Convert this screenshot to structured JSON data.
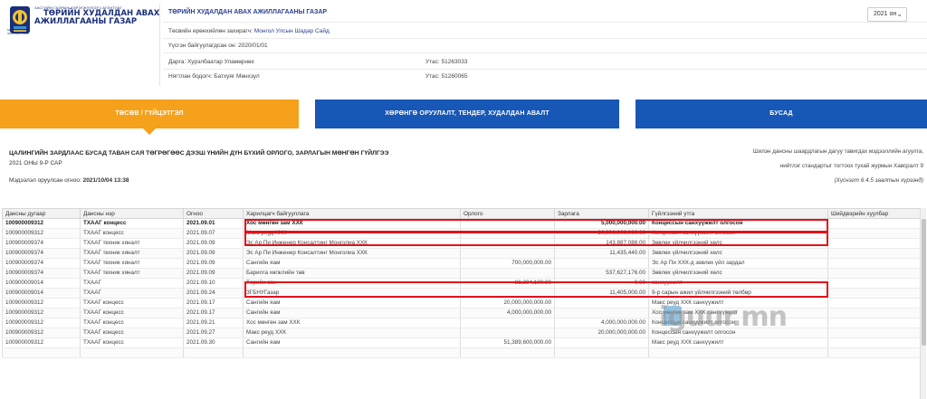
{
  "header": {
    "logo_small": "ЗАСГИЙН ГАЗРЫН ХЭРЭГЖҮҮЛЭГЧ АГЕНТЛАГ",
    "logo_line1": "ТӨРИЙН ХУДАЛДАН АВАХ",
    "logo_line2": "АЖИЛЛАГААНЫ ГАЗАР",
    "emblem_side_text": "МОНГОЛ УЛСЫН ЗАСГИЙН ГАЗАР",
    "org_title": "ТӨРИЙН ХУДАЛДАН АВАХ АЖИЛЛАГААНЫ ГАЗАР",
    "budget_manager_label": "Төсвийн ерөнхийлөн захирагч:",
    "budget_manager_value": "Монгол Улсын Шадар Сайд",
    "established_label": "Үүсгэн байгуулагдсан он: 2020/01/01",
    "director": "Дарга: Хурэлбаатар Уламөрнөх",
    "director_phone": "Утас: 51263033",
    "accountant": "Нягтлан бодогч: Батхуяг Мөнхзул",
    "accountant_phone": "Утас: 51260065",
    "year": "2021 он",
    "year_chevron": "⌄"
  },
  "tabs": [
    {
      "label": "ТӨСӨВ / ГҮЙЦЭТГЭЛ"
    },
    {
      "label": "ХӨРӨНГӨ ОРУУЛАЛТ, ТЕНДЕР, ХУДАЛДАН АВАЛТ"
    },
    {
      "label": "БУСАД"
    }
  ],
  "report": {
    "title": "ЦАЛИНГИЙН ЗАРДЛААС БУСАД ТАВАН САЯ ТӨГРӨГӨӨС ДЭЭШ ҮНИЙН ДҮН БҮХИЙ ОРЛОГО, ЗАРЛАГЫН МӨНГӨН ГҮЙЛГЭЭ",
    "subtitle": "2021 ОНЫ 9-Р САР",
    "date_label": "Мэдээлэл оруулсан огноо:",
    "date_value": "2021/10/04 13:38",
    "note_line1": "Шилэн дансны шаардлагын дагуу тавигдах мэдээллийн агуулга,",
    "note_line2": "нийтлэг стандартыг тогтоох тухай журмын Хавсралт 9",
    "note_line3": "(Хүснэгт 6.4.5 заалтын хүрээнд)"
  },
  "table": {
    "headers": [
      "Дансны дугаар",
      "Дансны нэр",
      "Огноо",
      "Харилцагч байгууллага",
      "Орлого",
      "Зарлага",
      "Гүйлгээний утга",
      "Шийдвэрийн хуулбар"
    ],
    "rows": [
      {
        "acc": "100900009312",
        "name": "ТХААГ концесс",
        "date": "2021.09.01",
        "party": "Хос мөнгөн зам ХХК",
        "income": "",
        "expense": "5,000,000,000.00",
        "purpose": "Концессын санхүүжилт олгосон",
        "doc": "",
        "bold": true
      },
      {
        "acc": "100900009312",
        "name": "ТХААГ концесс",
        "date": "2021.09.07",
        "party": "Макс реуд ХХК",
        "income": "",
        "expense": "20,000,000,000.00",
        "purpose": "Концессын санхүүжилт олгосон",
        "doc": ""
      },
      {
        "acc": "100900009374",
        "name": "ТХААГ техник хяналт",
        "date": "2021.09.09",
        "party": "Эс Ар Пи Инженер Консалтинг Монголиа ХХК",
        "income": "",
        "expense": "143,887,088.00",
        "purpose": "Зөвлөх үйлчилгээний хөлс",
        "doc": ""
      },
      {
        "acc": "100900009374",
        "name": "ТХААГ техник хяналт",
        "date": "2021.09.09",
        "party": "Эс Ар Пи Инженер Консалтинг Монголиа ХХК",
        "income": "",
        "expense": "11,435,440.00",
        "purpose": "Зөвлөх үйлчилгээний хөлс",
        "doc": ""
      },
      {
        "acc": "100900009374",
        "name": "ТХААГ техник хяналт",
        "date": "2021.09.09",
        "party": "Сангийн яам",
        "income": "700,000,000.00",
        "expense": "",
        "purpose": "Эс Ар Пи ХХК-д зөвлөх үйл зардал",
        "doc": ""
      },
      {
        "acc": "100900009374",
        "name": "ТХААГ техник хяналт",
        "date": "2021.09.09",
        "party": "Барилга хөгжлийн төв",
        "income": "",
        "expense": "537,627,176.00",
        "purpose": "Зөвлөх үйлчилгээний хөлс",
        "doc": ""
      },
      {
        "acc": "100900009014",
        "name": "ТХААГ",
        "date": "2021.09.10",
        "party": "Төрийн сан",
        "income": "81,394,100.00",
        "expense": "0.00",
        "purpose": "санхүүжилт",
        "doc": ""
      },
      {
        "acc": "100900009014",
        "name": "ТХААГ",
        "date": "2021.09.24",
        "party": "ЗГБНУГазар",
        "income": "",
        "expense": "11,405,000.00",
        "purpose": "9-р сарын ажил үйлчилгээний төлбөр",
        "doc": ""
      },
      {
        "acc": "100900009312",
        "name": "ТХААГ концесс",
        "date": "2021.09.17",
        "party": "Сангийн яам",
        "income": "20,000,000,000.00",
        "expense": "",
        "purpose": "Макс реуд ХХК санхүүжилт",
        "doc": ""
      },
      {
        "acc": "100900009312",
        "name": "ТХААГ концесс",
        "date": "2021.09.17",
        "party": "Сангийн яам",
        "income": "4,000,000,000.00",
        "expense": "",
        "purpose": "Хос мөнгөн зам ХХК санхүүжилт",
        "doc": ""
      },
      {
        "acc": "100900009312",
        "name": "ТХААГ концесс",
        "date": "2021.09.21",
        "party": "Хос мөнгөн зам ХХК",
        "income": "",
        "expense": "4,000,000,000.00",
        "purpose": "Концессын санхүүжилт олгосон",
        "doc": ""
      },
      {
        "acc": "100900009312",
        "name": "ТХААГ концесс",
        "date": "2021.09.27",
        "party": "Макс реуд ХХК",
        "income": "",
        "expense": "20,000,000,000.00",
        "purpose": "Концессын санхүүжилт олгосон",
        "doc": ""
      },
      {
        "acc": "100900009312",
        "name": "ТХААГ концесс",
        "date": "2021.09.30",
        "party": "Сангийн яам",
        "income": "51,389,600,000.00",
        "expense": "",
        "purpose": "Макс реуд ХХК санхүүжилт",
        "doc": ""
      },
      {
        "acc": "",
        "name": "",
        "date": "",
        "party": "",
        "income": "",
        "expense": "",
        "purpose": "",
        "doc": ""
      }
    ]
  },
  "watermark": "iguur.mn",
  "colors": {
    "tab_active": "#f5a11b",
    "tab_inactive": "#1757b5",
    "highlight": "#e2121b",
    "brand_text": "#1a2f7a"
  }
}
